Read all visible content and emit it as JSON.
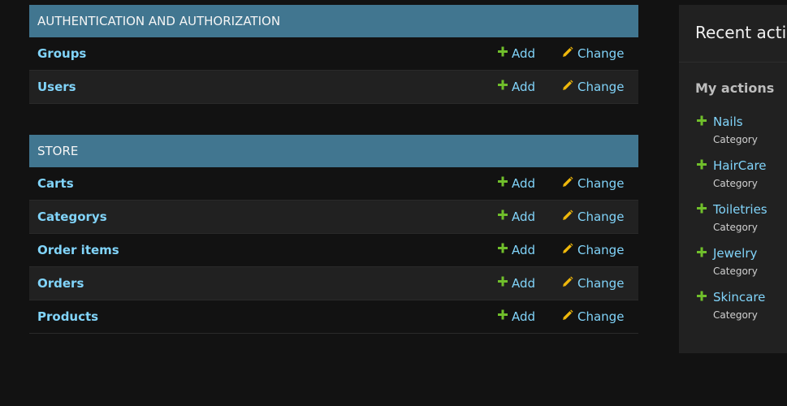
{
  "colors": {
    "page_background": "#121212",
    "module_header": "#417690",
    "link": "#81d4fa",
    "add_icon": "#70bf2b",
    "change_icon": "#efb80b",
    "row_alt": "#212121",
    "sidebar_background": "#212121"
  },
  "modules": [
    {
      "title": "AUTHENTICATION AND AUTHORIZATION",
      "models": [
        {
          "name": "Groups",
          "add_label": "Add",
          "change_label": "Change"
        },
        {
          "name": "Users",
          "add_label": "Add",
          "change_label": "Change"
        }
      ]
    },
    {
      "title": "STORE",
      "models": [
        {
          "name": "Carts",
          "add_label": "Add",
          "change_label": "Change"
        },
        {
          "name": "Categorys",
          "add_label": "Add",
          "change_label": "Change"
        },
        {
          "name": "Order items",
          "add_label": "Add",
          "change_label": "Change"
        },
        {
          "name": "Orders",
          "add_label": "Add",
          "change_label": "Change"
        },
        {
          "name": "Products",
          "add_label": "Add",
          "change_label": "Change"
        }
      ]
    }
  ],
  "recent_actions": {
    "title": "Recent actions",
    "my_actions_label": "My actions",
    "items": [
      {
        "name": "Nails",
        "type": "Category",
        "icon": "plus-icon"
      },
      {
        "name": "HairCare",
        "type": "Category",
        "icon": "plus-icon"
      },
      {
        "name": "Toiletries",
        "type": "Category",
        "icon": "plus-icon"
      },
      {
        "name": "Jewelry",
        "type": "Category",
        "icon": "plus-icon"
      },
      {
        "name": "Skincare",
        "type": "Category",
        "icon": "plus-icon"
      }
    ]
  }
}
